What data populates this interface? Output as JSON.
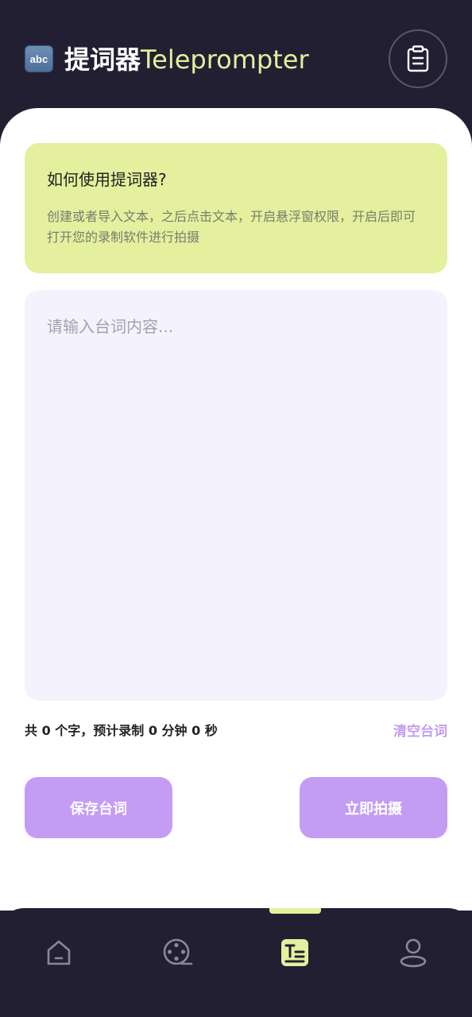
{
  "header": {
    "app_icon_text": "abc",
    "title_cn": "提词器",
    "title_en": "Teleprompter",
    "clipboard_icon": "clipboard-icon"
  },
  "howto": {
    "title": "如何使用提词器?",
    "text": "创建或者导入文本，之后点击文本，开启悬浮窗权限，开启后即可打开您的录制软件进行拍摄"
  },
  "editor": {
    "placeholder": "请输入台词内容..."
  },
  "stats": {
    "text": "共 0 个字，预计录制 0 分钟 0 秒",
    "clear_label": "清空台词"
  },
  "actions": {
    "save_label": "保存台词",
    "shoot_label": "立即拍摄"
  },
  "tabbar": {
    "items": [
      {
        "icon": "home-icon",
        "active": false
      },
      {
        "icon": "film-reel-icon",
        "active": false
      },
      {
        "icon": "teleprompter-icon",
        "active": true
      },
      {
        "icon": "profile-icon",
        "active": false
      }
    ]
  },
  "colors": {
    "background": "#231f33",
    "accent_green": "#e4f09e",
    "accent_purple": "#c59cf3",
    "editor_bg": "#f4f3fd"
  }
}
